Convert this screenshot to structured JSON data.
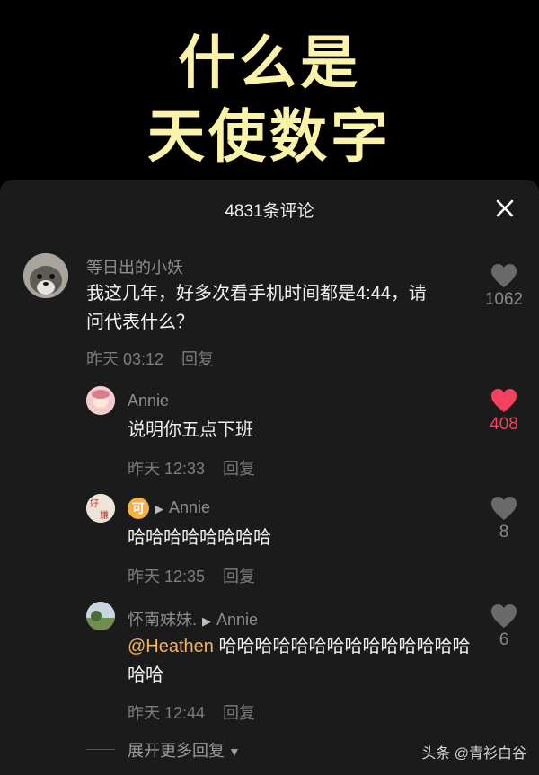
{
  "video": {
    "title_line1": "什么是",
    "title_line2": "天使数字"
  },
  "panel": {
    "comment_count": "4831条评论"
  },
  "comments": [
    {
      "username": "等日出的小妖",
      "text": "我这几年，好多次看手机时间都是4:44，请问代表什么？",
      "time": "昨天 03:12",
      "reply_label": "回复",
      "likes": "1062",
      "liked": false
    }
  ],
  "replies": [
    {
      "username": "Annie",
      "text": "说明你五点下班",
      "time": "昨天 12:33",
      "reply_label": "回复",
      "likes": "408",
      "liked": true
    },
    {
      "badge": "可",
      "reply_to": "Annie",
      "text": "哈哈哈哈哈哈哈哈",
      "time": "昨天 12:35",
      "reply_label": "回复",
      "likes": "8",
      "liked": false
    },
    {
      "username": "怀南妹妹.",
      "reply_to": "Annie",
      "mention": "@Heathen",
      "text": "哈哈哈哈哈哈哈哈哈哈哈哈哈哈哈哈",
      "time": "昨天 12:44",
      "reply_label": "回复",
      "likes": "6",
      "liked": false
    }
  ],
  "expand_label": "展开更多回复",
  "watermark": "头条 @青衫白谷",
  "colors": {
    "liked": "#f2425e",
    "mention": "#f5b45c",
    "title": "#fbf3a8",
    "panel_bg": "#1b1b1b"
  }
}
